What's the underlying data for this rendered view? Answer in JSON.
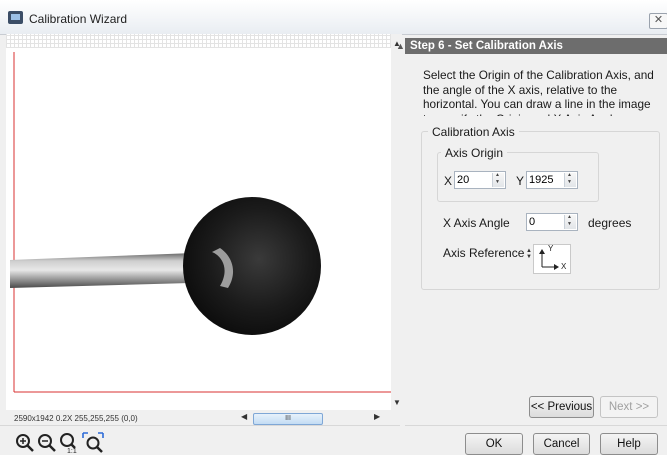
{
  "window": {
    "title": "Calibration Wizard",
    "close_glyph": "✕"
  },
  "viewer": {
    "status_text": "2590x1942 0.2X 255,255,255   (0,0)",
    "hscroll_thumb": "III",
    "zoom_tools": [
      "zoom-in-icon",
      "zoom-out-icon",
      "zoom-1to1-icon",
      "zoom-fit-icon"
    ]
  },
  "wizard": {
    "step_title": "Step 6 - Set Calibration Axis",
    "instructions": "Select the Origin of the Calibration Axis, and the angle of the X axis, relative to the horizontal. You can draw a line in the image to specify the Origin and X Axis Angle.",
    "calibration_axis_group": "Calibration Axis",
    "axis_origin_group": "Axis Origin",
    "x_label": "X",
    "x_value": "20",
    "y_label": "Y",
    "y_value": "1925",
    "angle_label": "X Axis Angle",
    "angle_value": "0",
    "angle_unit": "degrees",
    "axis_reference_label": "Axis Reference",
    "axis_reference_y": "Y",
    "axis_reference_x": "X",
    "previous_label": "<< Previous",
    "next_label": "Next >>"
  },
  "footer": {
    "ok_label": "OK",
    "cancel_label": "Cancel",
    "help_label": "Help"
  },
  "colors": {
    "axis_red": "#d93030",
    "header_gray": "#6d6d6d",
    "ball_black": "#141414"
  }
}
